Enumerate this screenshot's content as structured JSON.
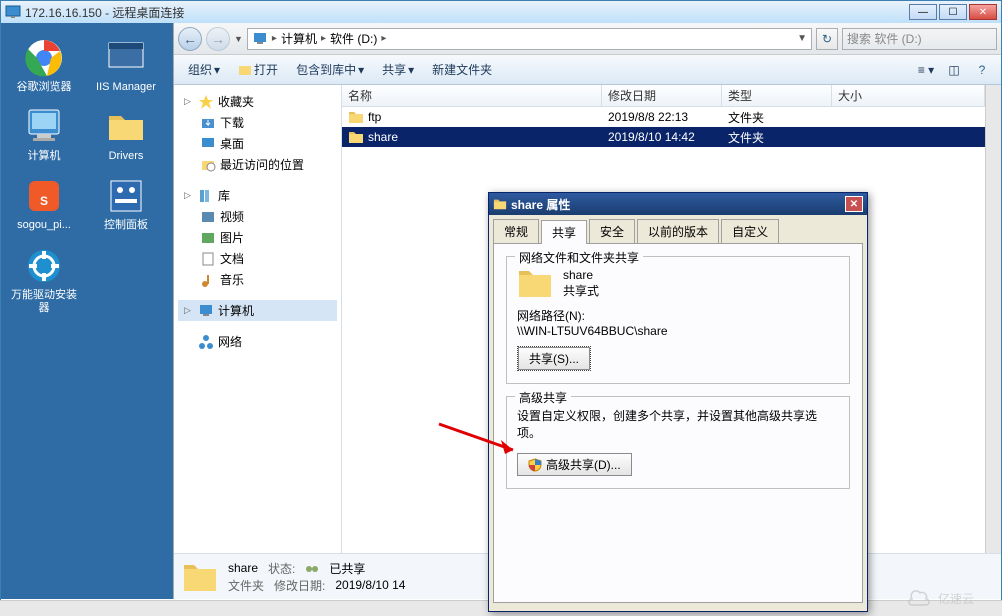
{
  "rdp": {
    "ip": "172.16.16.150",
    "title_suffix": "- 远程桌面连接"
  },
  "desktop_icons": [
    {
      "label": "谷歌浏览器"
    },
    {
      "label": "IIS Manager"
    },
    {
      "label": "计算机"
    },
    {
      "label": "Drivers"
    },
    {
      "label": "sogou_pi..."
    },
    {
      "label": "控制面板"
    },
    {
      "label": "万能驱动安装器"
    }
  ],
  "explorer": {
    "address_parts": {
      "root": "计算机",
      "drive": "软件 (D:)"
    },
    "refresh_glyph": "↻",
    "search_placeholder": "搜索 软件 (D:)",
    "toolbar": {
      "organize": "组织",
      "open": "打开",
      "include": "包含到库中",
      "share": "共享",
      "newfolder": "新建文件夹"
    },
    "nav": {
      "favorites": "收藏夹",
      "downloads": "下载",
      "desktop": "桌面",
      "recent": "最近访问的位置",
      "libraries": "库",
      "videos": "视频",
      "pictures": "图片",
      "documents": "文档",
      "music": "音乐",
      "computer": "计算机",
      "network": "网络"
    },
    "columns": {
      "name": "名称",
      "date": "修改日期",
      "type": "类型",
      "size": "大小"
    },
    "files": [
      {
        "name": "ftp",
        "date": "2019/8/8 22:13",
        "type": "文件夹"
      },
      {
        "name": "share",
        "date": "2019/8/10 14:42",
        "type": "文件夹"
      }
    ],
    "status": {
      "name": "share",
      "state_label": "状态:",
      "state_value": "已共享",
      "type": "文件夹",
      "date_label": "修改日期:",
      "date_value": "2019/8/10 14"
    }
  },
  "dialog": {
    "title": "share 属性",
    "tabs": {
      "general": "常规",
      "share": "共享",
      "security": "安全",
      "prev": "以前的版本",
      "custom": "自定义"
    },
    "group1_title": "网络文件和文件夹共享",
    "share_name": "share",
    "share_state": "共享式",
    "path_label": "网络路径(N):",
    "path_value": "\\\\WIN-LT5UV64BBUC\\share",
    "share_btn": "共享(S)...",
    "group2_title": "高级共享",
    "adv_desc": "设置自定义权限，创建多个共享，并设置其他高级共享选项。",
    "adv_btn": "高级共享(D)..."
  },
  "watermark": "亿速云"
}
